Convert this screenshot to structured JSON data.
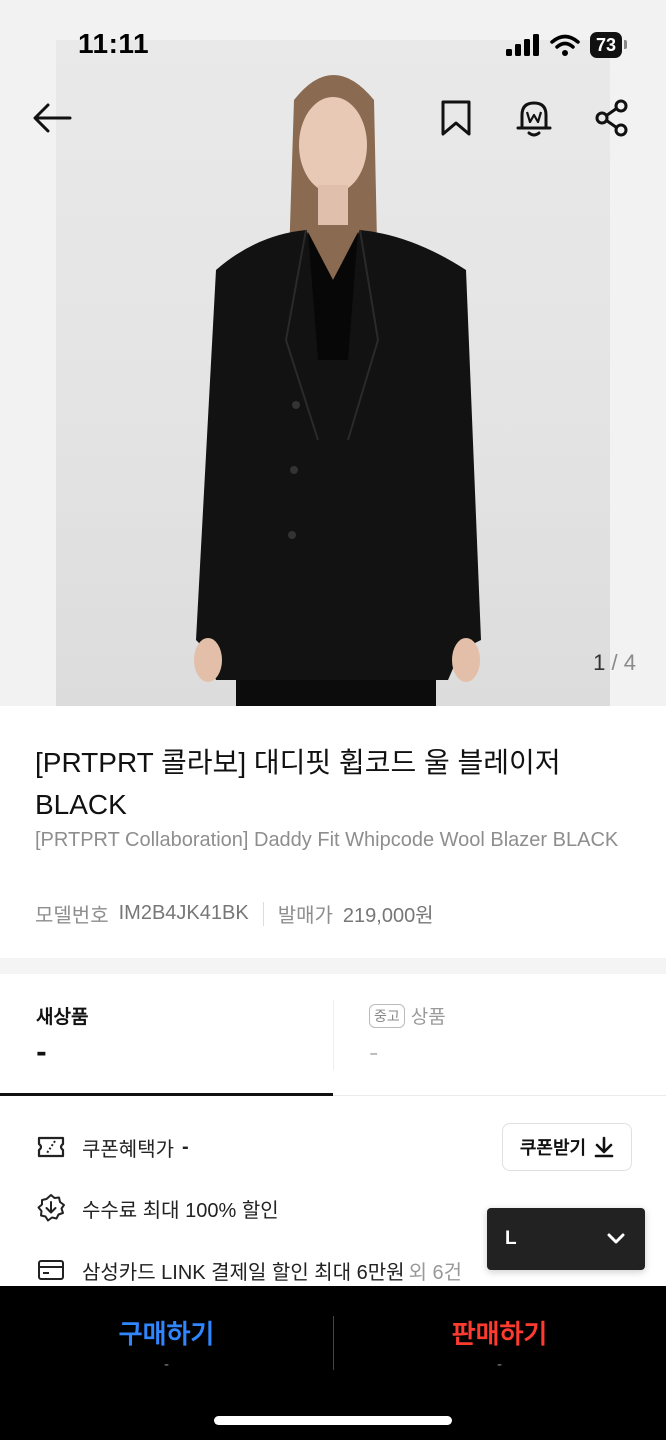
{
  "status_bar": {
    "time": "11:11",
    "battery": "73"
  },
  "gallery": {
    "current": "1",
    "separator": "/",
    "total": "4"
  },
  "product": {
    "title_ko": "[PRTPRT 콜라보] 대디핏 휩코드 울 블레이저 BLACK",
    "title_en": "[PRTPRT Collaboration] Daddy Fit Whipcode Wool Blazer BLACK",
    "model_label": "모델번호",
    "model_number": "IM2B4JK41BK",
    "release_label": "발매가",
    "release_price": "219,000원"
  },
  "tabs": {
    "new_label": "새상품",
    "new_price": "-",
    "used_badge": "중고",
    "used_label": "상품",
    "used_price": "-"
  },
  "benefits": {
    "coupon_label": "쿠폰혜택가",
    "coupon_value": "-",
    "coupon_button": "쿠폰받기",
    "fee_text": "수수료 최대 100% 할인",
    "card_text": "삼성카드 LINK 결제일 할인 최대 6만원",
    "card_extra": "외 6건"
  },
  "size_select": {
    "value": "L"
  },
  "bottom_bar": {
    "buy_label": "구매하기",
    "buy_price": "-",
    "sell_label": "판매하기",
    "sell_price": "-"
  },
  "icons": {
    "back": "back-arrow-icon",
    "bookmark": "bookmark-icon",
    "alarm": "bell-icon",
    "share": "share-icon"
  },
  "colors": {
    "buy": "#2f86ff",
    "sell": "#ff3b30"
  }
}
